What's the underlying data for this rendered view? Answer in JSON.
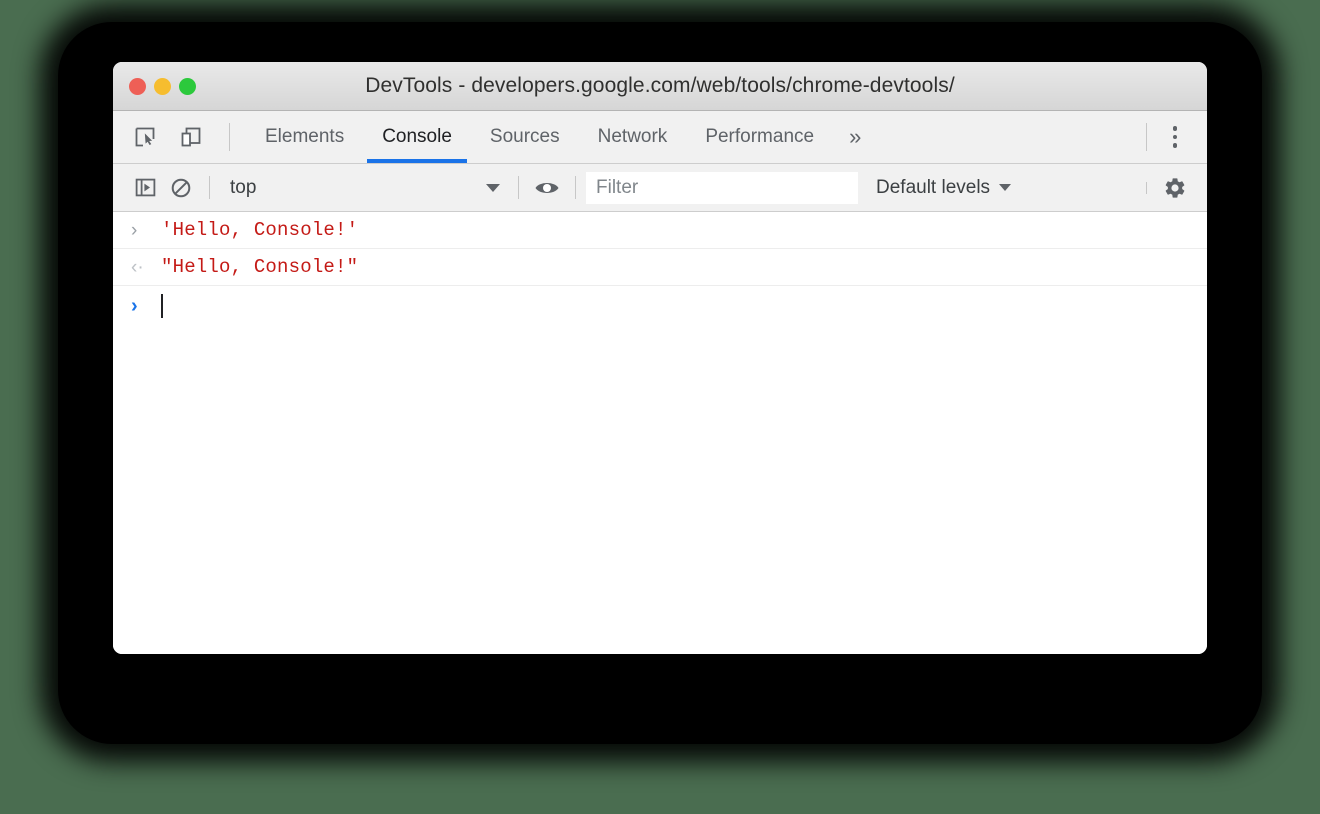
{
  "window": {
    "title": "DevTools - developers.google.com/web/tools/chrome-devtools/",
    "traffic_lights": [
      {
        "name": "close",
        "color": "#ee5f56"
      },
      {
        "name": "minimize",
        "color": "#f6bd2f"
      },
      {
        "name": "zoom",
        "color": "#2cc93c"
      }
    ]
  },
  "tabbar": {
    "left_buttons": [
      {
        "icon": "inspect-element-icon",
        "label": "Inspect element"
      },
      {
        "icon": "device-toolbar-icon",
        "label": "Toggle device toolbar"
      }
    ],
    "tabs": [
      {
        "label": "Elements",
        "active": false
      },
      {
        "label": "Console",
        "active": true
      },
      {
        "label": "Sources",
        "active": false
      },
      {
        "label": "Network",
        "active": false
      },
      {
        "label": "Performance",
        "active": false
      }
    ],
    "overflow_label": "»",
    "menu_icon": "kebab-menu-icon",
    "active_underline_color": "#1a73e8"
  },
  "console_toolbar": {
    "sidebar_toggle_icon": "console-sidebar-toggle-icon",
    "clear_icon": "clear-console-icon",
    "context": {
      "value": "top",
      "caret": "▼"
    },
    "eye_icon": "live-expression-eye-icon",
    "filter": {
      "value": "",
      "placeholder": "Filter"
    },
    "levels": {
      "label": "Default levels",
      "caret": "▼"
    },
    "settings_icon": "settings-gear-icon"
  },
  "console": {
    "rows": [
      {
        "type": "input",
        "gutter": "›",
        "text": "'Hello, Console!'",
        "color": "#c41a16"
      },
      {
        "type": "output",
        "gutter": "‹·",
        "text": "\"Hello, Console!\"",
        "color": "#c41a16"
      }
    ],
    "prompt": {
      "gutter": "›",
      "value": "",
      "cursor": true,
      "color": "#1a73e8"
    }
  },
  "colors": {
    "page_background": "#4a6d50",
    "shadow": "#000000",
    "window_background": "#ffffff",
    "toolbar_background": "#f1f1f1",
    "accent": "#1a73e8",
    "string_red": "#c41a16"
  }
}
